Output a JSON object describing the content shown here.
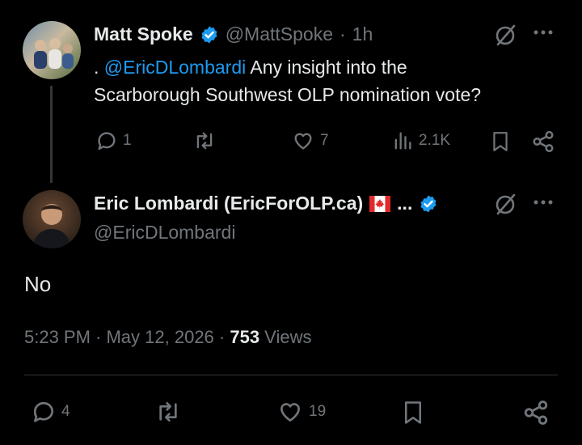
{
  "reply": {
    "author_name": "Matt Spoke",
    "handle": "@MattSpoke",
    "separator": "·",
    "time": "1h",
    "text_prefix": ". ",
    "mention": "@EricDLombardi",
    "text_line1": " Any insight into the",
    "text_line2": "Scarborough Southwest OLP nomination  vote?",
    "replies": "1",
    "reposts": "",
    "likes": "7",
    "views": "2.1K"
  },
  "main": {
    "author_name": "Eric Lombardi (EricForOLP.ca)",
    "ellipsis": "...",
    "handle": "@EricDLombardi",
    "text": "No",
    "timestamp": "5:23 PM · May 12, 2026 · ",
    "views_count": "753",
    "views_label": " Views",
    "replies": "4",
    "likes": "19"
  },
  "colors": {
    "accent": "#1d9bf0",
    "verified": "#1d9bf0",
    "muted": "#71767b",
    "text": "#e7e9ea"
  },
  "icons": [
    "verified-badge-icon",
    "grok-icon",
    "more-icon",
    "reply-icon",
    "repost-icon",
    "like-icon",
    "views-icon",
    "bookmark-icon",
    "share-icon",
    "canada-flag-icon"
  ]
}
